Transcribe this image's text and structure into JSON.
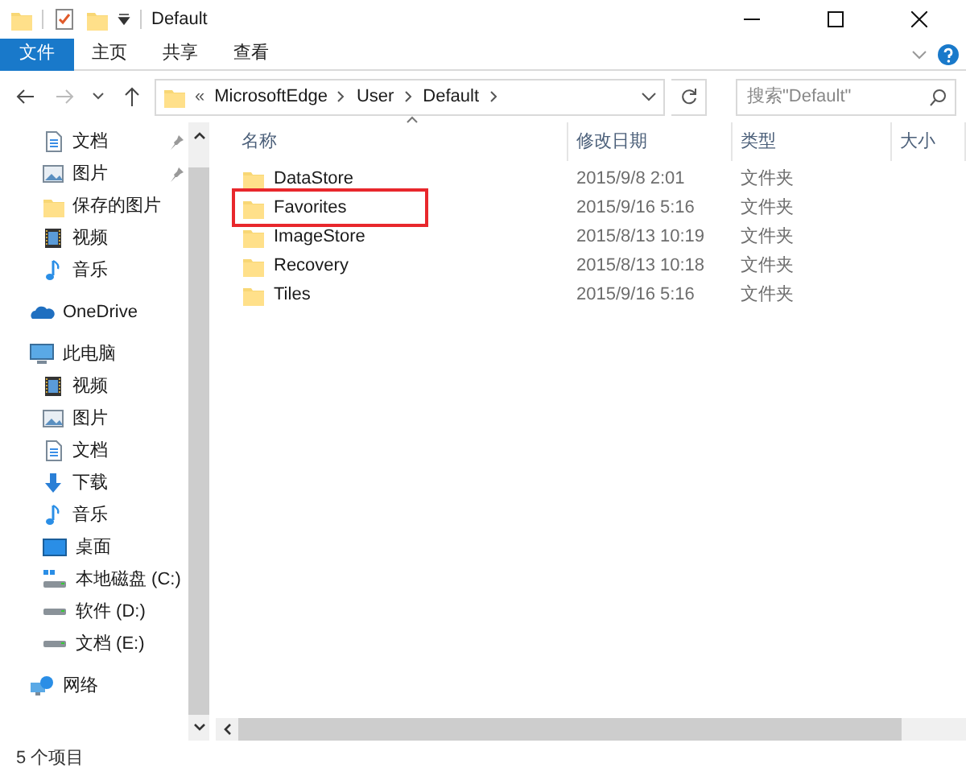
{
  "window": {
    "title": "Default"
  },
  "ribbon_tabs": [
    {
      "label": "文件",
      "selected": true
    },
    {
      "label": "主页",
      "selected": false
    },
    {
      "label": "共享",
      "selected": false
    },
    {
      "label": "查看",
      "selected": false
    }
  ],
  "address_bar": {
    "overflow": "«",
    "crumbs": [
      "MicrosoftEdge",
      "User",
      "Default"
    ]
  },
  "search": {
    "placeholder": "搜索\"Default\""
  },
  "sidebar": {
    "quick_access_items": [
      {
        "label": "文档",
        "kind": "document",
        "pinned": true
      },
      {
        "label": "图片",
        "kind": "image",
        "pinned": true
      },
      {
        "label": "保存的图片",
        "kind": "folder",
        "pinned": false
      },
      {
        "label": "视频",
        "kind": "video",
        "pinned": false
      },
      {
        "label": "音乐",
        "kind": "music",
        "pinned": false
      }
    ],
    "items": [
      {
        "label": "OneDrive",
        "kind": "cloud"
      },
      {
        "label": "此电脑",
        "kind": "computer",
        "children": [
          {
            "label": "视频",
            "kind": "video"
          },
          {
            "label": "图片",
            "kind": "image"
          },
          {
            "label": "文档",
            "kind": "document"
          },
          {
            "label": "下载",
            "kind": "download"
          },
          {
            "label": "音乐",
            "kind": "music"
          },
          {
            "label": "桌面",
            "kind": "desktop"
          },
          {
            "label": "本地磁盘 (C:)",
            "kind": "system-drive"
          },
          {
            "label": "软件 (D:)",
            "kind": "drive"
          },
          {
            "label": "文档 (E:)",
            "kind": "drive"
          }
        ]
      },
      {
        "label": "网络",
        "kind": "network"
      }
    ]
  },
  "file_list": {
    "columns": [
      "名称",
      "修改日期",
      "类型",
      "大小"
    ],
    "rows": [
      {
        "name": "DataStore",
        "modified": "2015/9/8 2:01",
        "type": "文件夹",
        "highlighted": false
      },
      {
        "name": "Favorites",
        "modified": "2015/9/16 5:16",
        "type": "文件夹",
        "highlighted": true
      },
      {
        "name": "ImageStore",
        "modified": "2015/8/13 10:19",
        "type": "文件夹",
        "highlighted": false
      },
      {
        "name": "Recovery",
        "modified": "2015/8/13 10:18",
        "type": "文件夹",
        "highlighted": false
      },
      {
        "name": "Tiles",
        "modified": "2015/9/16 5:16",
        "type": "文件夹",
        "highlighted": false
      }
    ]
  },
  "status_bar": {
    "item_count": "5 个项目"
  }
}
